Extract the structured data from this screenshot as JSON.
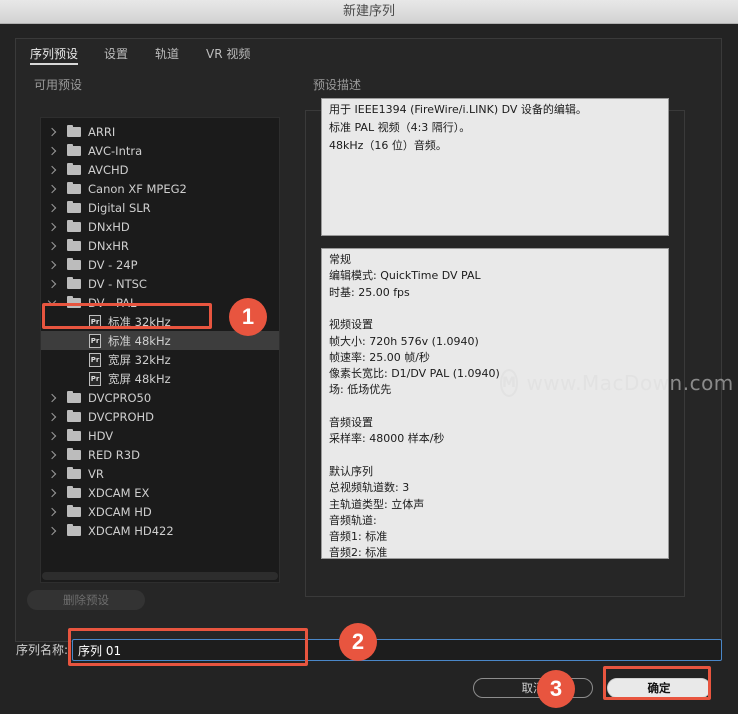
{
  "window": {
    "title": "新建序列"
  },
  "tabs": [
    {
      "label": "序列预设"
    },
    {
      "label": "设置"
    },
    {
      "label": "轨道"
    },
    {
      "label": "VR 视频"
    }
  ],
  "presets": {
    "group_label": "可用预设",
    "tree": [
      {
        "label": "ARRI",
        "type": "folder",
        "expanded": false
      },
      {
        "label": "AVC-Intra",
        "type": "folder",
        "expanded": false
      },
      {
        "label": "AVCHD",
        "type": "folder",
        "expanded": false
      },
      {
        "label": "Canon XF MPEG2",
        "type": "folder",
        "expanded": false
      },
      {
        "label": "Digital SLR",
        "type": "folder",
        "expanded": false
      },
      {
        "label": "DNxHD",
        "type": "folder",
        "expanded": false
      },
      {
        "label": "DNxHR",
        "type": "folder",
        "expanded": false
      },
      {
        "label": "DV - 24P",
        "type": "folder",
        "expanded": false
      },
      {
        "label": "DV - NTSC",
        "type": "folder",
        "expanded": false
      },
      {
        "label": "DV - PAL",
        "type": "folder",
        "expanded": true
      },
      {
        "label": "标准 32kHz",
        "type": "preset"
      },
      {
        "label": "标准 48kHz",
        "type": "preset",
        "selected": true
      },
      {
        "label": "宽屏 32kHz",
        "type": "preset"
      },
      {
        "label": "宽屏 48kHz",
        "type": "preset"
      },
      {
        "label": "DVCPRO50",
        "type": "folder",
        "expanded": false
      },
      {
        "label": "DVCPROHD",
        "type": "folder",
        "expanded": false
      },
      {
        "label": "HDV",
        "type": "folder",
        "expanded": false
      },
      {
        "label": "RED R3D",
        "type": "folder",
        "expanded": false
      },
      {
        "label": "VR",
        "type": "folder",
        "expanded": false
      },
      {
        "label": "XDCAM EX",
        "type": "folder",
        "expanded": false
      },
      {
        "label": "XDCAM HD",
        "type": "folder",
        "expanded": false
      },
      {
        "label": "XDCAM HD422",
        "type": "folder",
        "expanded": false
      }
    ],
    "delete_button": "删除预设"
  },
  "description": {
    "group_label": "预设描述",
    "summary": [
      "用于 IEEE1394 (FireWire/i.LINK) DV 设备的编辑。",
      "标准 PAL 视频（4:3 隔行）。",
      "48kHz（16 位）音频。"
    ],
    "details": [
      "常规",
      " 编辑模式: QuickTime DV PAL",
      " 时基: 25.00 fps",
      "",
      "视频设置",
      " 帧大小: 720h 576v (1.0940)",
      " 帧速率: 25.00  帧/秒",
      " 像素长宽比: D1/DV PAL (1.0940)",
      " 场: 低场优先",
      "",
      "音频设置",
      " 采样率: 48000 样本/秒",
      "",
      "默认序列",
      " 总视频轨道数: 3",
      " 主轨道类型: 立体声",
      " 音频轨道:",
      " 音频1: 标准",
      " 音频2: 标准"
    ]
  },
  "watermark": {
    "icon": "M",
    "text": "www.MacDown.com"
  },
  "sequence_name": {
    "label": "序列名称:",
    "value": "序列 01"
  },
  "buttons": {
    "cancel": "取消",
    "ok": "确定"
  },
  "callouts": [
    "1",
    "2",
    "3"
  ],
  "colors": {
    "callout": "#e8553f",
    "input_focus": "#4a87c8"
  }
}
